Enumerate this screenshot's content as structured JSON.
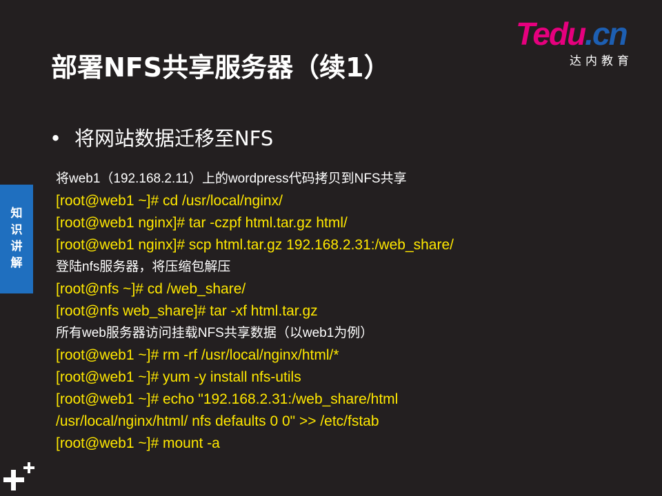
{
  "logo": {
    "brand_pink": "Tedu",
    "brand_blue": ".cn",
    "subtitle": "达内教育"
  },
  "title": "部署NFS共享服务器（续1）",
  "bullet": {
    "marker": "•",
    "text": "将网站数据迁移至NFS"
  },
  "side_tab": {
    "label": "知识讲解"
  },
  "lines": [
    {
      "kind": "note",
      "text": "将web1（192.168.2.11）上的wordpress代码拷贝到NFS共享"
    },
    {
      "kind": "cmd",
      "text": "[root@web1 ~]# cd /usr/local/nginx/"
    },
    {
      "kind": "cmd",
      "text": "[root@web1 nginx]# tar -czpf html.tar.gz html/"
    },
    {
      "kind": "cmd",
      "text": "[root@web1 nginx]# scp html.tar.gz 192.168.2.31:/web_share/"
    },
    {
      "kind": "note",
      "text": "登陆nfs服务器，将压缩包解压"
    },
    {
      "kind": "cmd",
      "text": "[root@nfs ~]# cd /web_share/"
    },
    {
      "kind": "cmd",
      "text": "[root@nfs web_share]# tar -xf html.tar.gz"
    },
    {
      "kind": "note",
      "text": "所有web服务器访问挂载NFS共享数据（以web1为例）"
    },
    {
      "kind": "cmd",
      "text": "[root@web1 ~]# rm -rf /usr/local/nginx/html/*"
    },
    {
      "kind": "cmd",
      "text": "[root@web1 ~]# yum -y install nfs-utils"
    },
    {
      "kind": "cmd",
      "text": "[root@web1 ~]# echo \"192.168.2.31:/web_share/html"
    },
    {
      "kind": "cmd",
      "text": "/usr/local/nginx/html/ nfs defaults 0 0\" >> /etc/fstab"
    },
    {
      "kind": "cmd",
      "text": "[root@web1 ~]# mount -a"
    }
  ],
  "colors": {
    "background": "#231f20",
    "command": "#ffe800",
    "note": "#ffffff",
    "tab": "#1f6fbf",
    "logo_pink": "#e6007e",
    "logo_blue": "#1d5fb3"
  },
  "icons": {
    "corner": "plus-icon"
  }
}
